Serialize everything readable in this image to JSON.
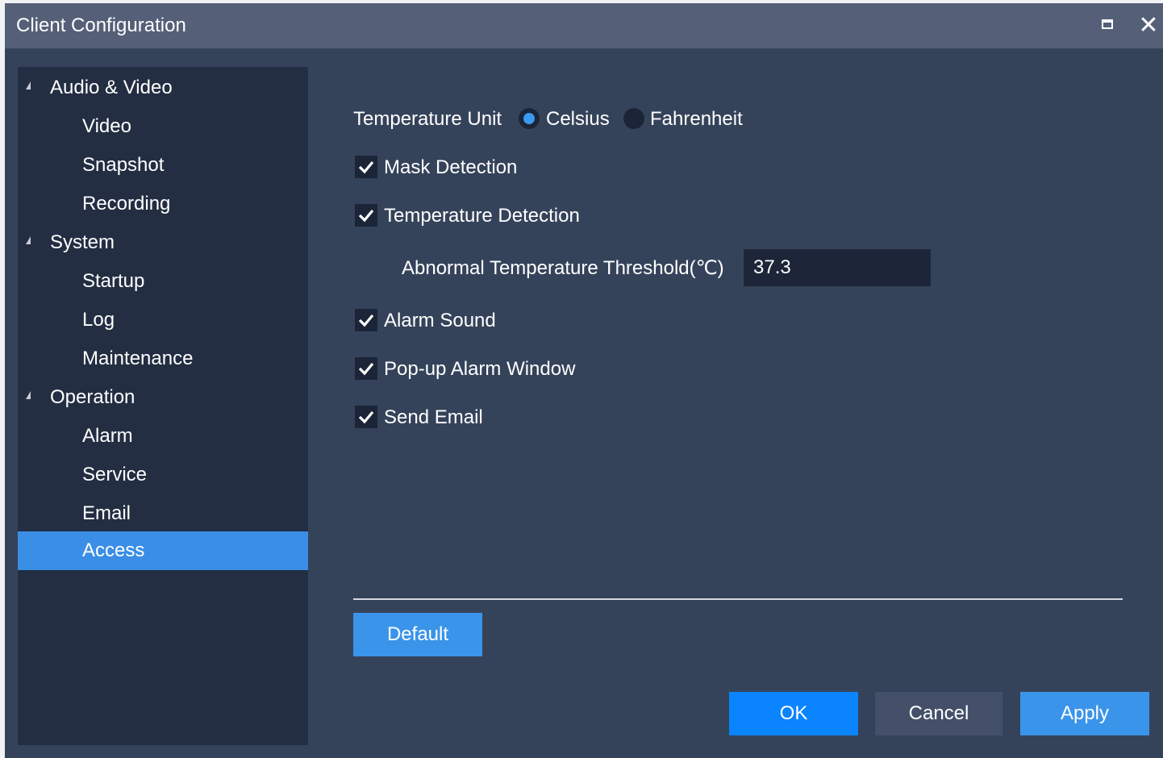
{
  "window": {
    "title": "Client Configuration",
    "maximize_icon": "maximize-icon",
    "close_glyph": "✕"
  },
  "sidebar": {
    "groups": [
      {
        "label": "Audio & Video",
        "items": [
          {
            "label": "Video"
          },
          {
            "label": "Snapshot"
          },
          {
            "label": "Recording"
          }
        ]
      },
      {
        "label": "System",
        "items": [
          {
            "label": "Startup"
          },
          {
            "label": "Log"
          },
          {
            "label": "Maintenance"
          }
        ]
      },
      {
        "label": "Operation",
        "items": [
          {
            "label": "Alarm"
          },
          {
            "label": "Service"
          },
          {
            "label": "Email"
          },
          {
            "label": "Access"
          }
        ]
      }
    ],
    "selected": "Access"
  },
  "settings": {
    "temperature_unit": {
      "label": "Temperature Unit",
      "options": [
        "Celsius",
        "Fahrenheit"
      ],
      "selected": "Celsius"
    },
    "mask_detection": {
      "label": "Mask Detection",
      "checked": true
    },
    "temperature_detection": {
      "label": "Temperature Detection",
      "checked": true
    },
    "threshold": {
      "label": "Abnormal Temperature Threshold(℃)",
      "value": "37.3"
    },
    "alarm_sound": {
      "label": "Alarm Sound",
      "checked": true
    },
    "popup_alarm_window": {
      "label": "Pop-up Alarm Window",
      "checked": true
    },
    "send_email": {
      "label": "Send Email",
      "checked": true
    }
  },
  "buttons": {
    "default": "Default",
    "ok": "OK",
    "cancel": "Cancel",
    "apply": "Apply"
  },
  "colors": {
    "accent": "#3a94ea",
    "selected_nav": "#3a8ee6",
    "window_bg": "#35435a",
    "sidebar_bg": "#232e42"
  }
}
